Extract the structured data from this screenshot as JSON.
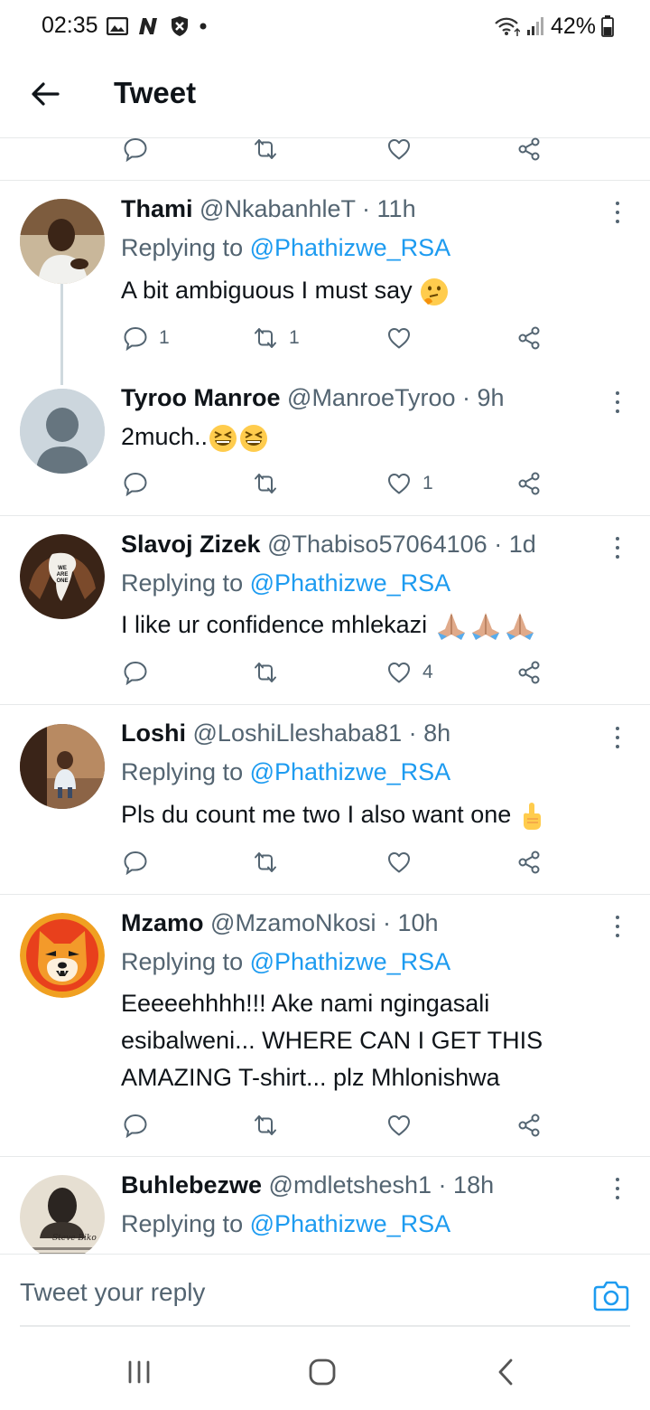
{
  "status_bar": {
    "time": "02:35",
    "battery": "42%"
  },
  "header": {
    "title": "Tweet"
  },
  "tweets": [
    {
      "name": "Thami",
      "handle": "@NkabanhleT",
      "time": "11h",
      "reply_label": "Replying to",
      "reply_to": "@Phathizwe_RSA",
      "text": "A bit ambiguous I must say",
      "emoji": "thinking-face",
      "replies": "1",
      "retweets": "1",
      "likes": ""
    },
    {
      "name": "Tyroo Manroe",
      "handle": "@ManroeTyroo",
      "time": "9h",
      "text": "2much..",
      "emoji": "grinning-squinting-face",
      "replies": "",
      "retweets": "",
      "likes": "1"
    },
    {
      "name": "Slavoj Zizek",
      "handle": "@Thabiso57064106",
      "time": "1d",
      "reply_label": "Replying to",
      "reply_to": "@Phathizwe_RSA",
      "text": "I like ur confidence mhlekazi",
      "emoji": "folded-hands",
      "avatar_text": [
        "WE",
        "ARE",
        "ONE"
      ],
      "replies": "",
      "retweets": "",
      "likes": "4"
    },
    {
      "name": "Loshi",
      "handle": "@LoshiLleshaba81",
      "time": "8h",
      "reply_label": "Replying to",
      "reply_to": "@Phathizwe_RSA",
      "text": "Pls du count me two I also want one",
      "emoji": "index-pointing-up",
      "replies": "",
      "retweets": "",
      "likes": ""
    },
    {
      "name": "Mzamo",
      "handle": "@MzamoNkosi",
      "time": "10h",
      "reply_label": "Replying to",
      "reply_to": "@Phathizwe_RSA",
      "text_lines": [
        "Eeeeehhhh!!! Ake nami ngingasali",
        "esibalweni... WHERE CAN I GET THIS",
        "AMAZING T-shirt... plz Mhlonishwa"
      ],
      "replies": "",
      "retweets": "",
      "likes": ""
    },
    {
      "name": "Buhlebezwe",
      "handle": "@mdletshesh1",
      "time": "18h",
      "reply_label": "Replying to",
      "reply_to": "@Phathizwe_RSA",
      "avatar_text": "Steve Biko"
    }
  ],
  "compose": {
    "placeholder": "Tweet your reply"
  },
  "colors": {
    "accent": "#1d9bf0",
    "secondary_text": "#536471",
    "divider": "#e7e9ea"
  }
}
